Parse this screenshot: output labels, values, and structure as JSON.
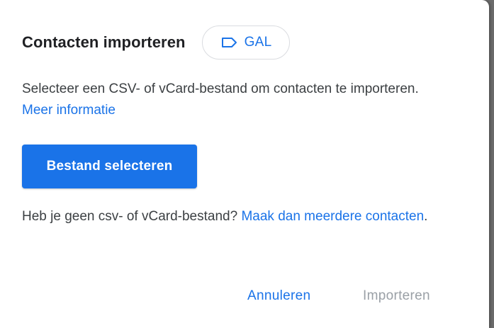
{
  "dialog": {
    "title": "Contacten importeren",
    "label_chip": {
      "icon": "label-icon",
      "text": "GAL"
    },
    "description": {
      "text": "Selecteer een CSV- of vCard-bestand om contacten te importeren. ",
      "link": "Meer informatie"
    },
    "select_file_button": "Bestand selecteren",
    "note": {
      "text": "Heb je geen csv- of vCard-bestand? ",
      "link": "Maak dan meerdere contacten",
      "suffix": "."
    },
    "actions": {
      "cancel": "Annuleren",
      "import": "Importeren"
    }
  },
  "colors": {
    "accent": "#1a73e8",
    "text": "#3c4043",
    "disabled": "#9aa0a6"
  }
}
